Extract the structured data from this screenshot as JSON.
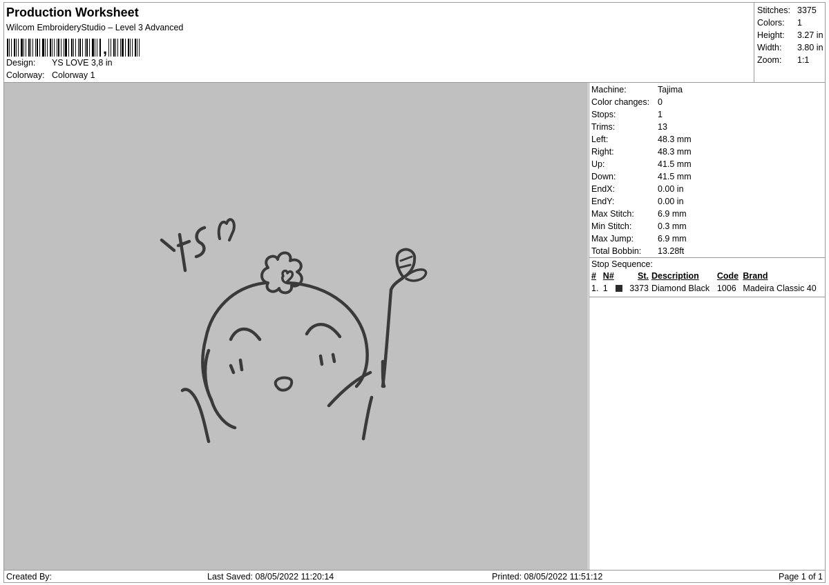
{
  "header": {
    "title": "Production Worksheet",
    "subtitle": "Wilcom EmbroideryStudio – Level 3 Advanced",
    "design_label": "Design:",
    "design_value": "YS LOVE 3,8 in",
    "colorway_label": "Colorway:",
    "colorway_value": "Colorway 1"
  },
  "summary": [
    {
      "k": "Stitches:",
      "v": "3375"
    },
    {
      "k": "Colors:",
      "v": "1"
    },
    {
      "k": "Height:",
      "v": "3.27 in"
    },
    {
      "k": "Width:",
      "v": "3.80 in"
    },
    {
      "k": "Zoom:",
      "v": "1:1"
    }
  ],
  "machine_info": [
    {
      "k": "Machine:",
      "v": "Tajima"
    },
    {
      "k": "Color changes:",
      "v": "0"
    },
    {
      "k": "Stops:",
      "v": "1"
    },
    {
      "k": "Trims:",
      "v": "13"
    },
    {
      "k": "Left:",
      "v": "48.3 mm"
    },
    {
      "k": "Right:",
      "v": "48.3 mm"
    },
    {
      "k": "Up:",
      "v": "41.5 mm"
    },
    {
      "k": "Down:",
      "v": "41.5 mm"
    },
    {
      "k": "EndX:",
      "v": "0.00 in"
    },
    {
      "k": "EndY:",
      "v": "0.00 in"
    },
    {
      "k": "Max Stitch:",
      "v": "6.9 mm"
    },
    {
      "k": "Min Stitch:",
      "v": "0.3 mm"
    },
    {
      "k": "Max Jump:",
      "v": "6.9 mm"
    },
    {
      "k": "Total Bobbin:",
      "v": "13.28ft"
    }
  ],
  "stop_sequence": {
    "title": "Stop Sequence:",
    "headers": {
      "num": "#",
      "n": "N#",
      "st": "St.",
      "description": "Description",
      "code": "Code",
      "brand": "Brand"
    },
    "rows": [
      {
        "num": "1.",
        "n": "1",
        "color": "#2b2b2b",
        "st": "3373",
        "description": "Diamond Black",
        "code": "1006",
        "brand": "Madeira Classic 40"
      }
    ]
  },
  "footer": {
    "created_by": "Created By:",
    "last_saved": "Last Saved: 08/05/2022 11:20:14",
    "printed": "Printed: 08/05/2022 11:51:12",
    "page": "Page 1 of 1"
  },
  "colors": {
    "preview_background": "#c0c0c0",
    "thread": "#3a3a3a"
  }
}
